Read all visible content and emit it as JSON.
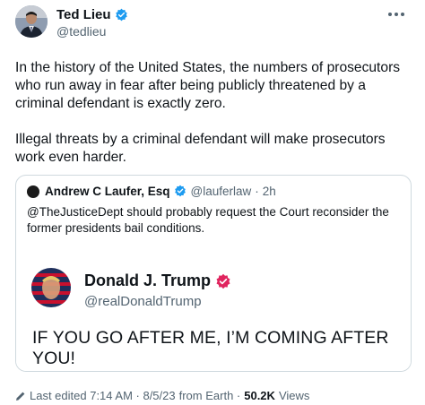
{
  "author": {
    "name": "Ted Lieu",
    "handle": "@tedlieu",
    "avatar_icon": "portrait-avatar",
    "verified_color": "#1d9bf0"
  },
  "tweet": {
    "paragraphs": [
      "In the history of the United States, the numbers of prosecutors who run away in fear after being publicly threatened by a criminal defendant is exactly zero.",
      "Illegal threats by a criminal defendant will make prosecutors work even harder."
    ]
  },
  "quote": {
    "name": "Andrew C Laufer, Esq",
    "handle": "@lauferlaw",
    "separator": "·",
    "time": "2h",
    "text": "@TheJusticeDept should probably request the Court reconsider the former presidents bail conditions.",
    "embedded": {
      "name": "Donald J. Trump",
      "handle": "@realDonaldTrump",
      "text": "IF YOU GO AFTER ME, I’M COMING AFTER YOU!",
      "badge_color": "#e0245e"
    }
  },
  "footer": {
    "edited": "Last edited 7:14 AM · 8/5/23",
    "source": "from Earth ·",
    "views_count": "50.2K",
    "views_label": "Views"
  },
  "colors": {
    "text": "#0f1419",
    "secondary": "#536471",
    "border": "#cfd9de"
  }
}
